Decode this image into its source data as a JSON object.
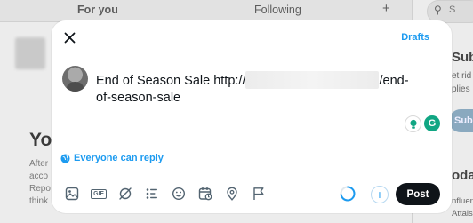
{
  "background": {
    "tabs": [
      "For you",
      "Following"
    ],
    "plus_glyph": "+",
    "heading": "You",
    "lines": [
      "After",
      "acco",
      "Repo",
      "think"
    ],
    "search_text": "S",
    "right_col": {
      "subs_title": "Subs",
      "subs_lines": [
        "et rid",
        "plies"
      ],
      "subs_button": "Subs",
      "today_title": "oday",
      "influence_lines": [
        "nfluen",
        "Attals"
      ]
    }
  },
  "composer": {
    "drafts_label": "Drafts",
    "text_prefix": "End of Season Sale http://",
    "text_suffix": "/end-",
    "text_line2": "of-season-sale",
    "reply_setting": "Everyone can reply",
    "post_label": "Post",
    "toolbar_icons": [
      "media-icon",
      "gif-icon",
      "grok-icon",
      "poll-icon",
      "emoji-icon",
      "schedule-icon",
      "location-icon",
      "flag-icon"
    ],
    "gif_label": "GIF",
    "progress": 0.72,
    "accent_color": "#1d9bf0"
  }
}
